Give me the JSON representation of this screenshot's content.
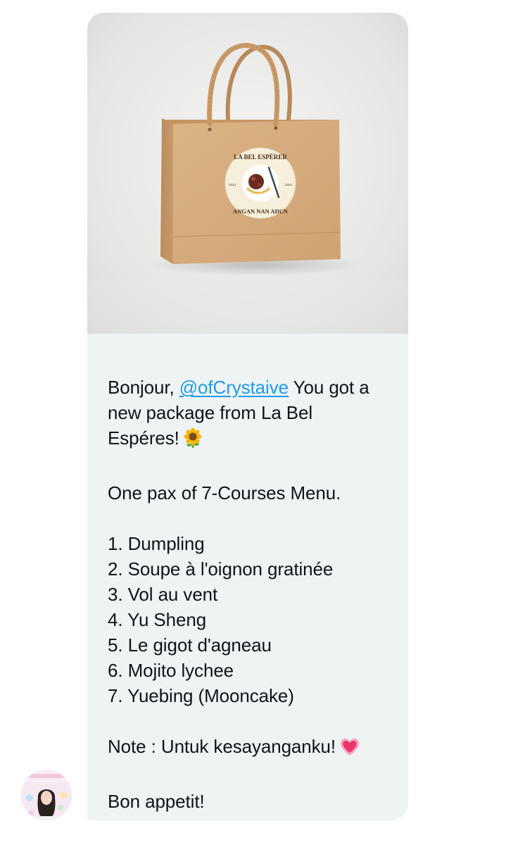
{
  "message": {
    "image": {
      "alt": "kraft-paper-shopping-bag-icon",
      "logo_top_text": "LA BEL ESPÉRER",
      "logo_bottom_text": "ANGAN NAN ADUN",
      "logo_left_year": "2013",
      "logo_right_year": "2023"
    },
    "greeting": "Bonjour,",
    "mention": "@ofCrystaive",
    "line1_rest": " You got a",
    "line2": "new package from La Bel",
    "line3": "Espéres!",
    "line3_emoji": "sunflower-icon",
    "line4": "One pax of 7-Courses Menu.",
    "menu_items": [
      "1. Dumpling",
      "2. Soupe à l'oignon gratinée",
      "3. Vol au vent",
      "4. Yu Sheng",
      "5. Le gigot d'agneau",
      "6. Mojito lychee",
      "7. Yuebing (Mooncake)"
    ],
    "note": "Note : Untuk kesayanganku!",
    "note_emoji": "growing-heart-icon",
    "closing": "Bon appetit!"
  },
  "sender": {
    "avatar": "user-avatar"
  },
  "colors": {
    "bubble_bg": "#eff3f4",
    "text": "#0f1419",
    "mention": "#1d9bf0",
    "bag": "#d4aa7d"
  }
}
